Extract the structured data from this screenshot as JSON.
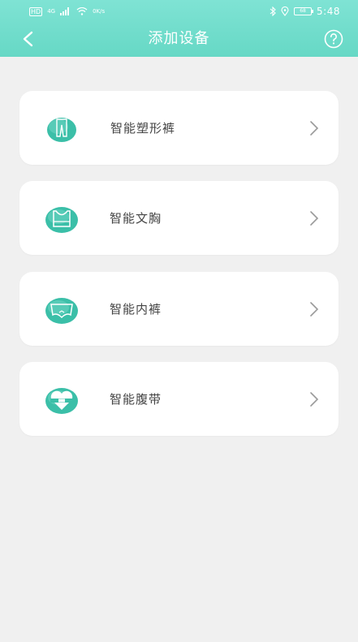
{
  "status_bar": {
    "hd_label": "HD",
    "signal_label": "4G",
    "wifi_speed": "0K/s",
    "battery": "68",
    "time": "5:48"
  },
  "nav": {
    "title": "添加设备"
  },
  "devices": [
    {
      "label": "智能塑形裤",
      "icon": "shaping-pants-icon"
    },
    {
      "label": "智能文胸",
      "icon": "bra-icon"
    },
    {
      "label": "智能内裤",
      "icon": "underwear-icon"
    },
    {
      "label": "智能腹带",
      "icon": "belly-band-icon"
    }
  ],
  "colors": {
    "header_top": "#7fe3d4",
    "header_bottom": "#66d8c5",
    "icon_circle": "#3bbfa8",
    "background": "#f0f0f0"
  }
}
